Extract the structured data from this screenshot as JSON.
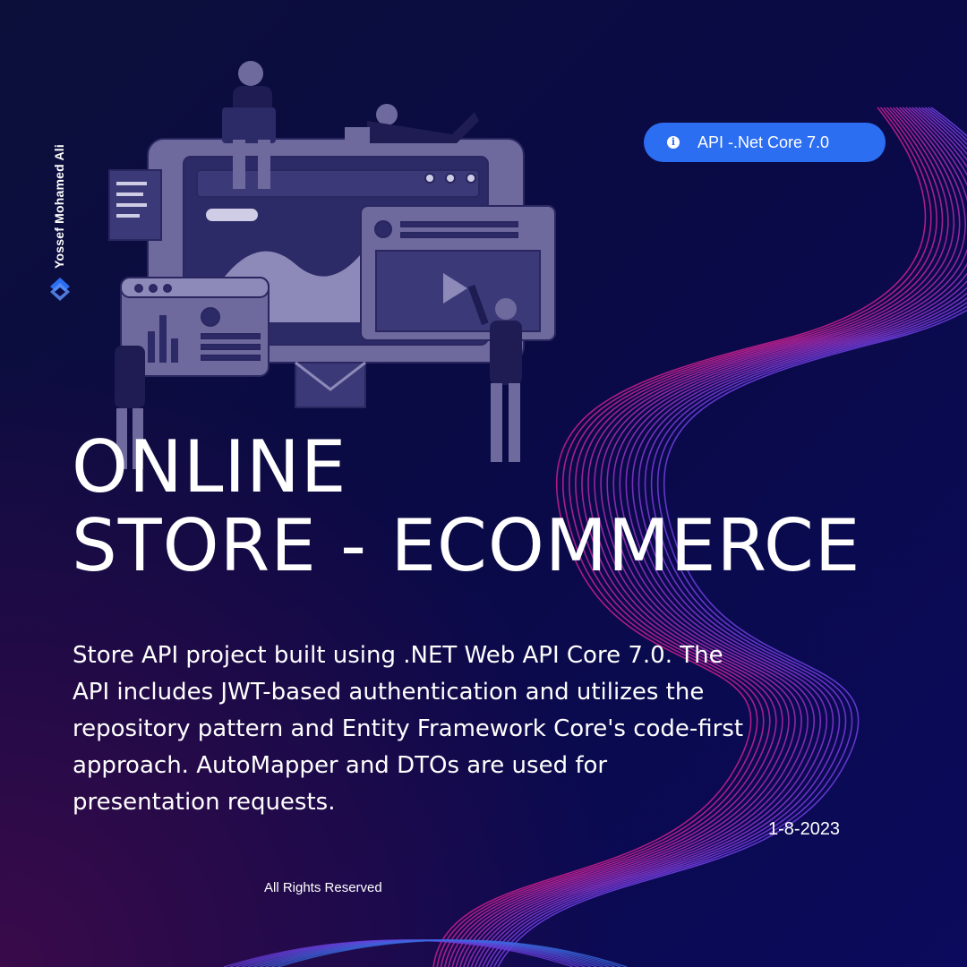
{
  "author": {
    "name": "Yossef Mohamed Ali",
    "logo_icon": "layered-diamond-logo"
  },
  "badge": {
    "icon": "info-icon",
    "icon_glyph": "i",
    "label": "API -.Net Core 7.0"
  },
  "title": {
    "line1": "ONLINE",
    "line2": "STORE - ECOMMERCE"
  },
  "description": "Store API project built using .NET Web API Core 7.0. The API includes JWT-based authentication and utilizes the repository pattern and Entity Framework Core's code-first approach. AutoMapper and DTOs are used for presentation requests.",
  "date": "1-8-2023",
  "footer": {
    "rights": "All Rights Reserved"
  },
  "colors": {
    "background": "#0a0a45",
    "accent_blue": "#2c6ef2",
    "wave_magenta": "#c01e8c",
    "wave_violet": "#6a3cd8",
    "illustration": "#6e6a9e"
  }
}
